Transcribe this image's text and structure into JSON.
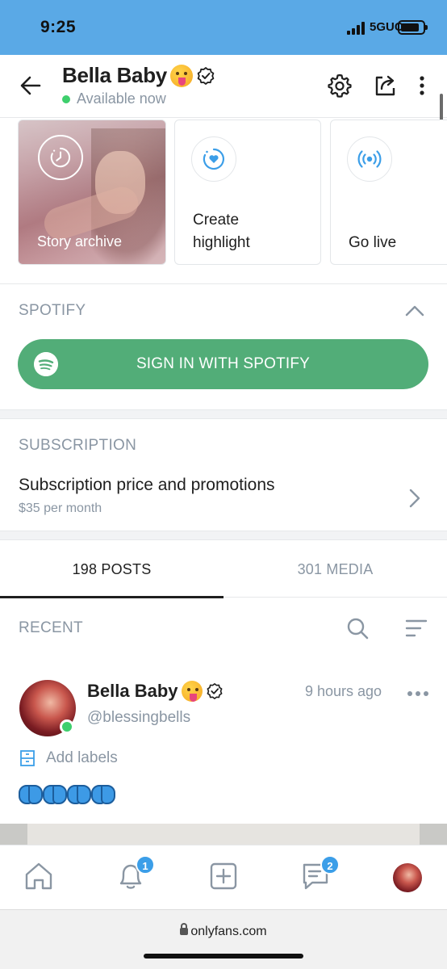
{
  "status_bar": {
    "time": "9:25",
    "network": "5GUC"
  },
  "header": {
    "profile_name": "Bella Baby",
    "status_text": "Available now"
  },
  "highlights": [
    {
      "label": "Story archive"
    },
    {
      "label_line1": "Create",
      "label_line2": "highlight"
    },
    {
      "label": "Go live"
    }
  ],
  "spotify": {
    "section_title": "SPOTIFY",
    "button_label": "SIGN IN WITH SPOTIFY"
  },
  "subscription": {
    "section_title": "SUBSCRIPTION",
    "title": "Subscription price and promotions",
    "price": "$35 per month"
  },
  "tabs": [
    {
      "label": "198 POSTS",
      "active": true
    },
    {
      "label": "301 MEDIA",
      "active": false
    }
  ],
  "feed": {
    "section_title": "RECENT",
    "post": {
      "author": "Bella Baby",
      "handle": "@blessingbells",
      "time": "9 hours ago",
      "labels_text": "Add labels",
      "content": "🦋🦋🦋🦋"
    }
  },
  "bottom_nav": {
    "notifications_badge": "1",
    "messages_badge": "2"
  },
  "browser": {
    "url": "onlyfans.com"
  },
  "colors": {
    "accent_blue": "#00aff0",
    "spotify_green": "#52ad78",
    "online_green": "#3ecf6d",
    "muted_text": "#8a96a3",
    "status_bar": "#5aa9e6"
  }
}
